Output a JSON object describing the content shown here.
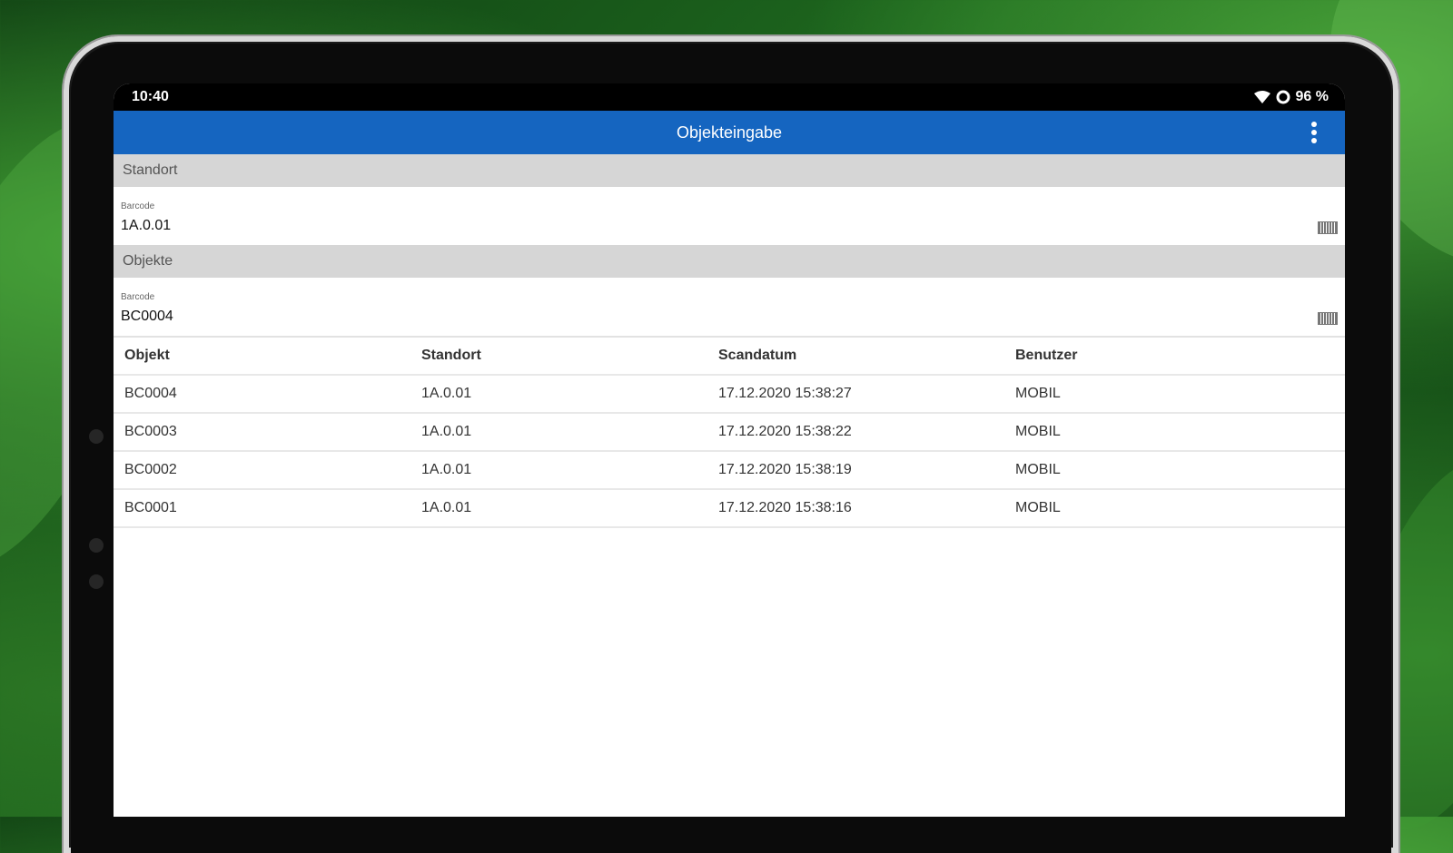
{
  "status_bar": {
    "time": "10:40",
    "battery": "96 %",
    "wifi_icon": "wifi-icon",
    "sync_icon": "sync-icon"
  },
  "app_bar": {
    "title": "Objekteingabe",
    "menu_icon": "more-vertical-icon"
  },
  "standort": {
    "section_label": "Standort",
    "field_label": "Barcode",
    "field_value": "1A.0.01",
    "scan_icon": "barcode-icon"
  },
  "objekte": {
    "section_label": "Objekte",
    "field_label": "Barcode",
    "field_value": "BC0004",
    "scan_icon": "barcode-icon"
  },
  "table": {
    "headers": [
      "Objekt",
      "Standort",
      "Scandatum",
      "Benutzer"
    ],
    "rows": [
      [
        "BC0004",
        "1A.0.01",
        "17.12.2020 15:38:27",
        "MOBIL"
      ],
      [
        "BC0003",
        "1A.0.01",
        "17.12.2020 15:38:22",
        "MOBIL"
      ],
      [
        "BC0002",
        "1A.0.01",
        "17.12.2020 15:38:19",
        "MOBIL"
      ],
      [
        "BC0001",
        "1A.0.01",
        "17.12.2020 15:38:16",
        "MOBIL"
      ]
    ]
  },
  "colors": {
    "app_bar": "#1565c0",
    "section_bg": "#d6d6d6",
    "status_bar": "#000000"
  }
}
